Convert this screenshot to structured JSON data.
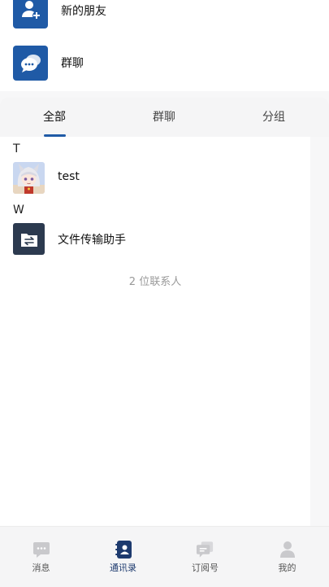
{
  "top_entries": [
    {
      "label": "新的朋友",
      "icon": "add-friend-icon"
    },
    {
      "label": "群聊",
      "icon": "group-chat-icon"
    }
  ],
  "tabs": [
    {
      "label": "全部",
      "active": true
    },
    {
      "label": "群聊",
      "active": false
    },
    {
      "label": "分组",
      "active": false
    }
  ],
  "contacts": {
    "groups": [
      {
        "letter": "T",
        "items": [
          {
            "name": "test",
            "avatar": "anime-avatar"
          }
        ]
      },
      {
        "letter": "W",
        "items": [
          {
            "name": "文件传输助手",
            "avatar": "file-transfer-icon"
          }
        ]
      }
    ],
    "count_label": "2 位联系人"
  },
  "bottom_nav": [
    {
      "label": "消息",
      "icon": "message-icon",
      "active": false
    },
    {
      "label": "通讯录",
      "icon": "contacts-icon",
      "active": true
    },
    {
      "label": "订阅号",
      "icon": "subscription-icon",
      "active": false
    },
    {
      "label": "我的",
      "icon": "profile-icon",
      "active": false
    }
  ],
  "colors": {
    "accent": "#1f5aa6",
    "muted": "#c9c9cc"
  }
}
